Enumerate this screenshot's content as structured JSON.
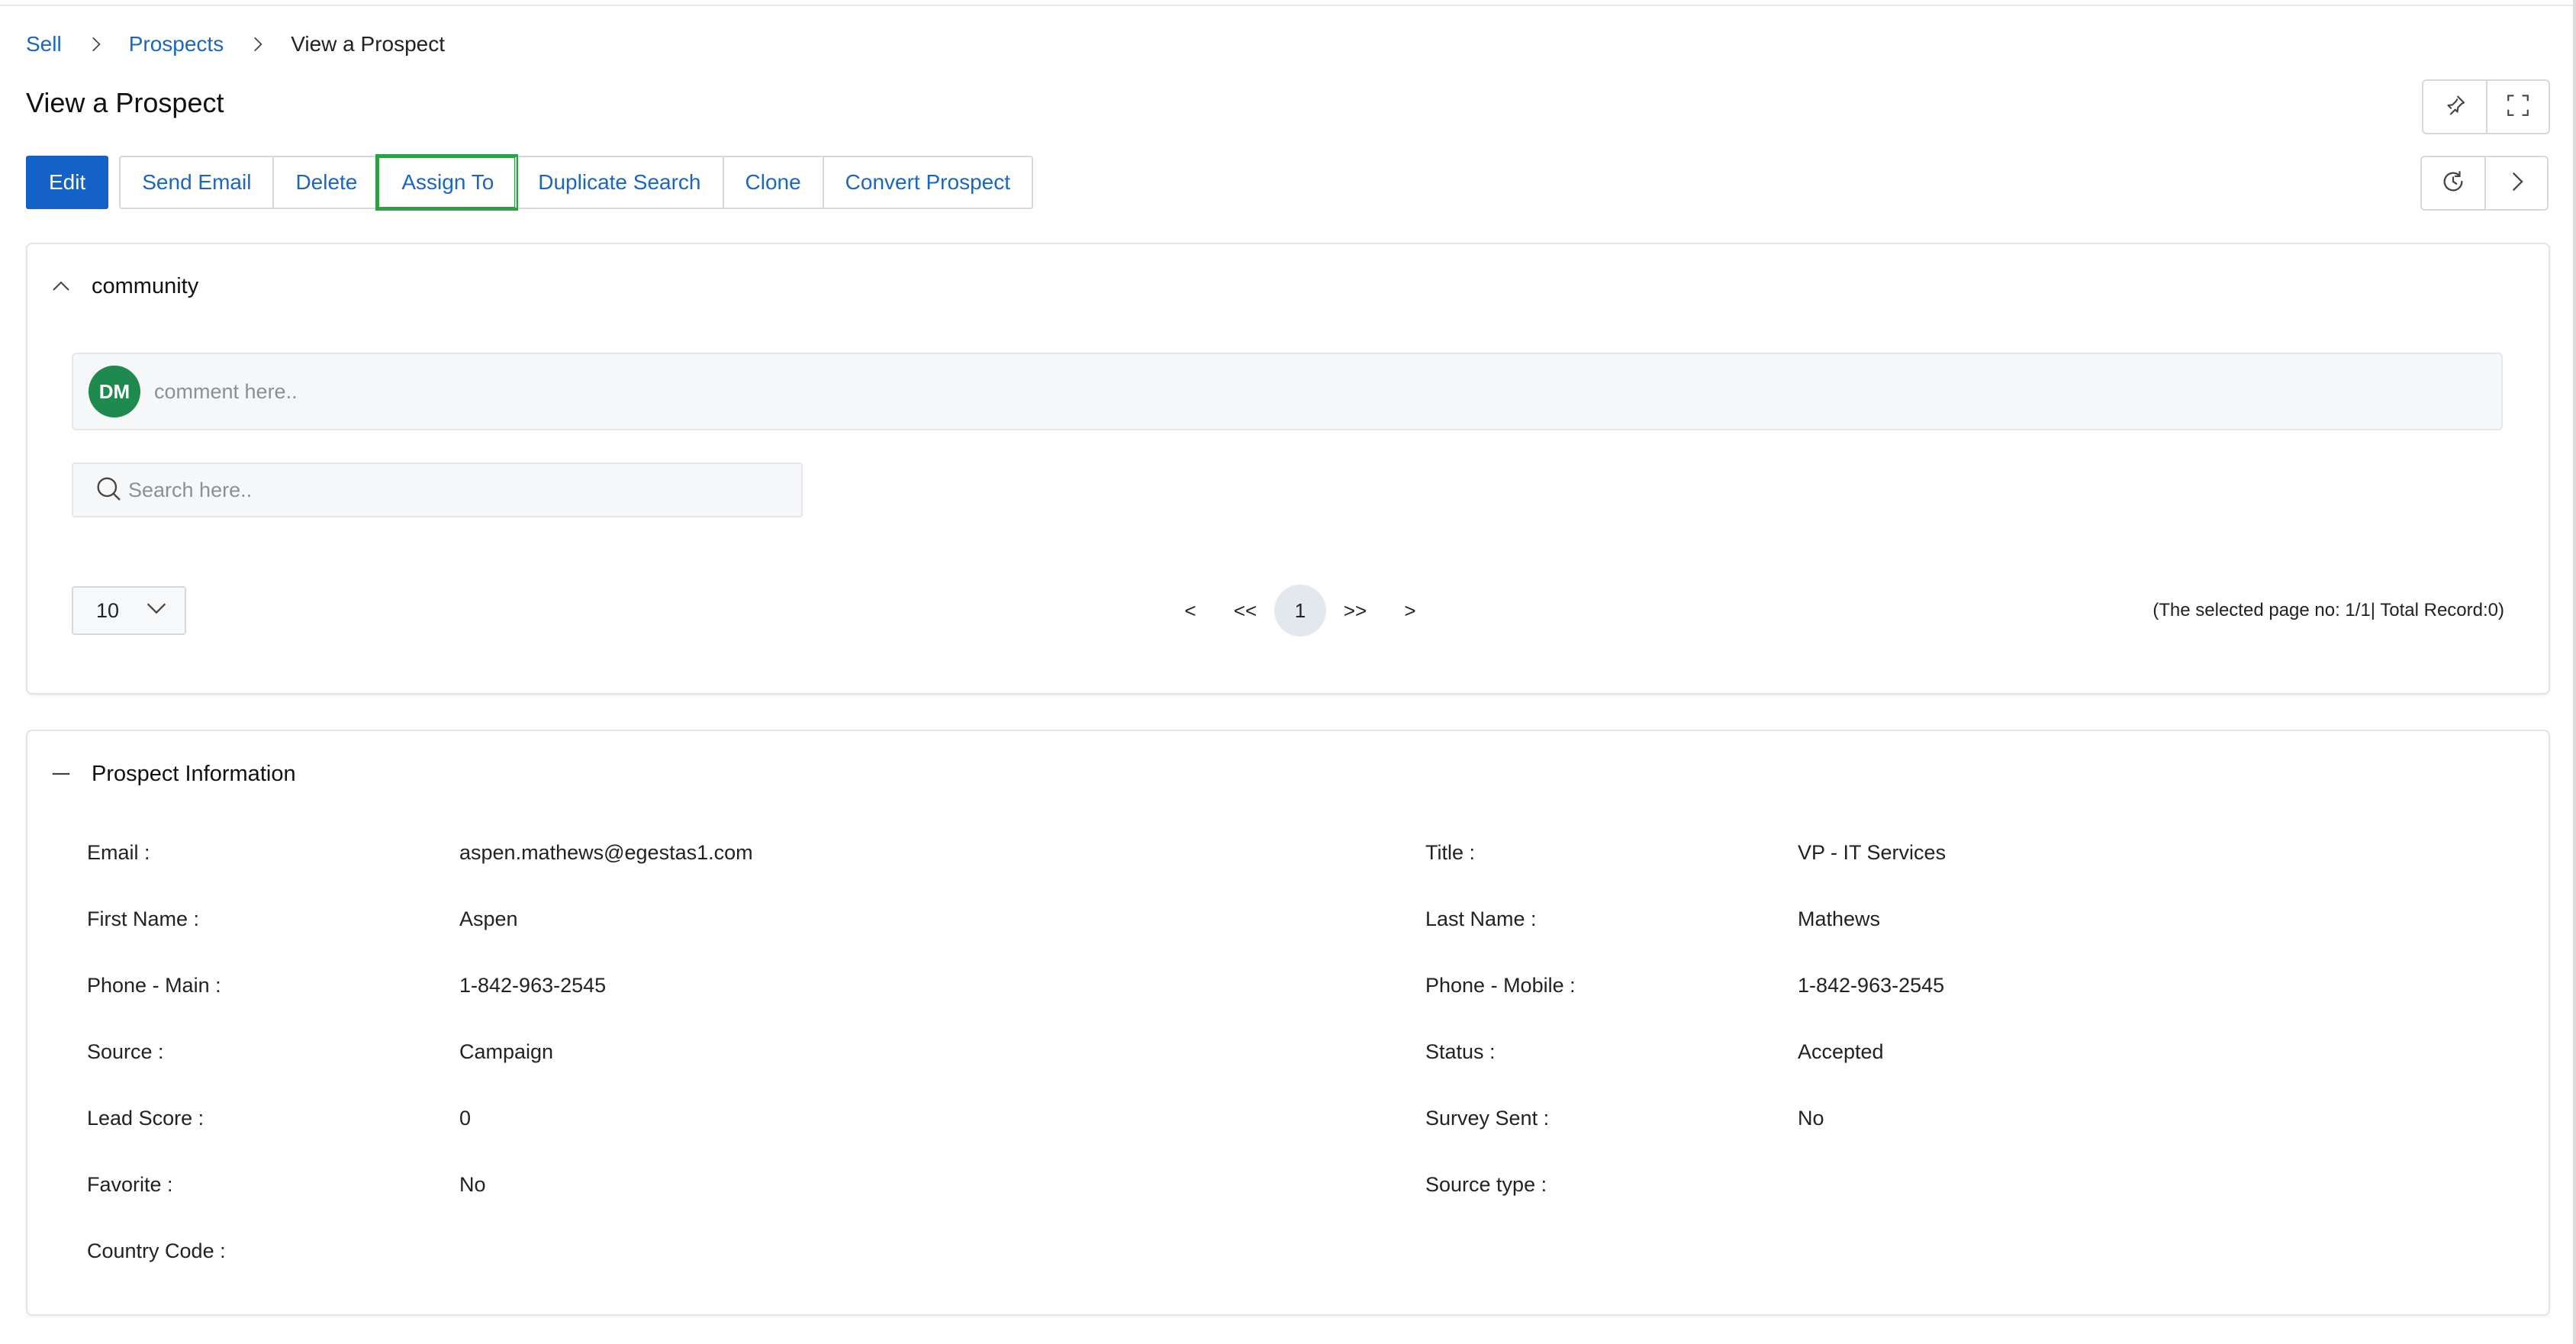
{
  "breadcrumb": {
    "items": [
      "Sell",
      "Prospects"
    ],
    "current": "View a Prospect"
  },
  "page_title": "View a Prospect",
  "toolbar": {
    "edit_label": "Edit",
    "buttons": [
      "Send Email",
      "Delete",
      "Assign To",
      "Duplicate Search",
      "Clone",
      "Convert Prospect"
    ],
    "highlighted": "Assign To"
  },
  "header_icons": [
    "pin-icon",
    "fullscreen-icon",
    "history-icon",
    "chevron-right-icon"
  ],
  "community": {
    "title": "community",
    "avatar_initials": "DM",
    "avatar_color": "#1f8a4d",
    "comment_placeholder": "comment here..",
    "search_placeholder": "Search here..",
    "page_size": "10",
    "pager": {
      "first": "<",
      "prev": "<<",
      "current": "1",
      "next": ">>",
      "last": ">"
    },
    "record_info": "(The selected page no: 1/1| Total Record:0)"
  },
  "prospect_info": {
    "title": "Prospect Information",
    "fields": [
      {
        "label": "Email :",
        "value": "aspen.mathews@egestas1.com"
      },
      {
        "label": "Title :",
        "value": "VP - IT Services"
      },
      {
        "label": "First Name :",
        "value": "Aspen"
      },
      {
        "label": "Last Name :",
        "value": "Mathews"
      },
      {
        "label": "Phone - Main :",
        "value": "1-842-963-2545"
      },
      {
        "label": "Phone - Mobile :",
        "value": "1-842-963-2545"
      },
      {
        "label": "Source :",
        "value": "Campaign"
      },
      {
        "label": "Status :",
        "value": "Accepted"
      },
      {
        "label": "Lead Score :",
        "value": "0"
      },
      {
        "label": "Survey Sent :",
        "value": "No"
      },
      {
        "label": "Favorite :",
        "value": "No"
      },
      {
        "label": "Source type :",
        "value": ""
      },
      {
        "label": "Country Code :",
        "value": ""
      }
    ]
  },
  "colors": {
    "primary": "#1462c7",
    "link": "#1a66c2",
    "highlight": "#2ea043"
  }
}
